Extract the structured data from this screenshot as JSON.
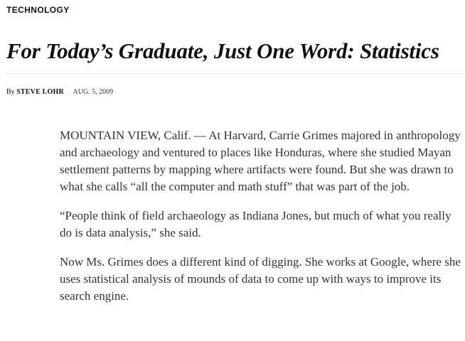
{
  "article": {
    "section": "TECHNOLOGY",
    "headline": "For Today’s Graduate, Just One Word: Statistics",
    "byline": {
      "prefix": "By",
      "author": "STEVE LOHR",
      "date": "AUG. 5, 2009"
    },
    "paragraphs": [
      "MOUNTAIN VIEW, Calif. — At Harvard, Carrie Grimes majored in anthropology and archaeology and ventured to places like Honduras, where she studied Mayan settlement patterns by mapping where artifacts were found. But she was drawn to what she calls “all the computer and math stuff” that was part of the job.",
      "“People think of field archaeology as Indiana Jones, but much of what you really do is data analysis,” she said.",
      "Now Ms. Grimes does a different kind of digging. She works at Google, where she uses statistical analysis of mounds of data to come up with ways to improve its search engine."
    ]
  }
}
